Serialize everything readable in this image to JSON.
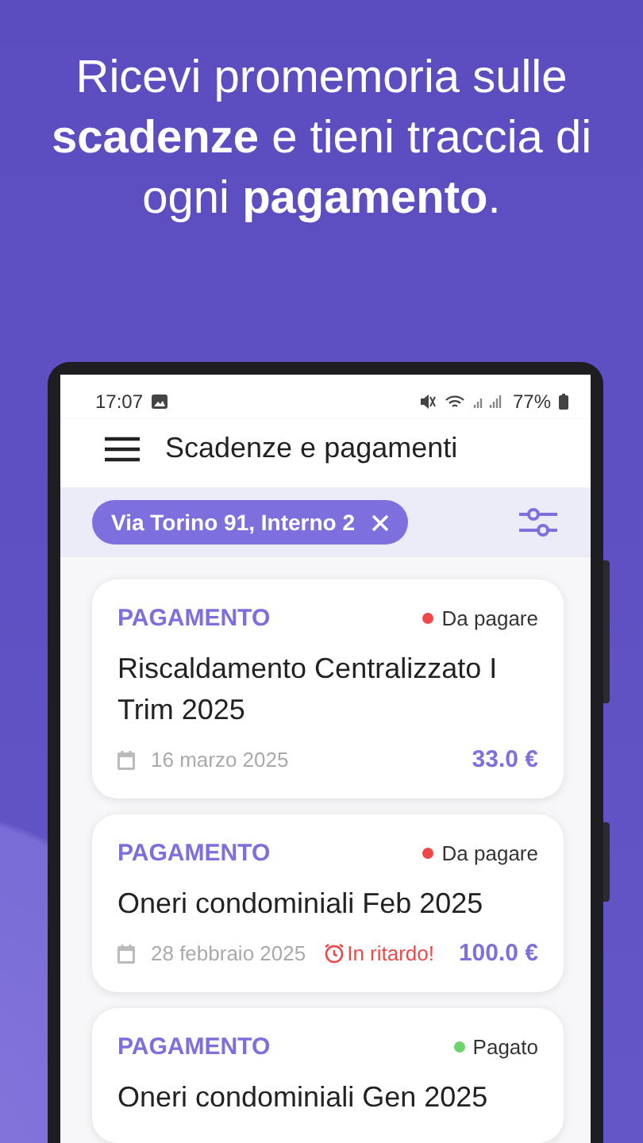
{
  "headline": "Ricevi promemoria sulle **scadenze** e tieni traccia di ogni **pagamento**.",
  "status_bar": {
    "time": "17:07",
    "battery": "77%"
  },
  "app_bar": {
    "title": "Scadenze e pagamenti"
  },
  "filter": {
    "chip": "Via Torino 91, Interno 2"
  },
  "cards": [
    {
      "type": "PAGAMENTO",
      "status": "Da pagare",
      "color": "#f04848",
      "title": "Riscaldamento Centralizzato I Trim 2025",
      "date": "16 marzo 2025",
      "amount": "33.0 €"
    },
    {
      "type": "PAGAMENTO",
      "status": "Da pagare",
      "color": "#f04848",
      "title": "Oneri condominiali Feb 2025",
      "date": "28 febbraio 2025",
      "late": "In ritardo!",
      "amount": "100.0 €"
    },
    {
      "type": "PAGAMENTO",
      "status": "Pagato",
      "color": "#6cd26a",
      "title": "Oneri condominiali Gen 2025"
    }
  ]
}
